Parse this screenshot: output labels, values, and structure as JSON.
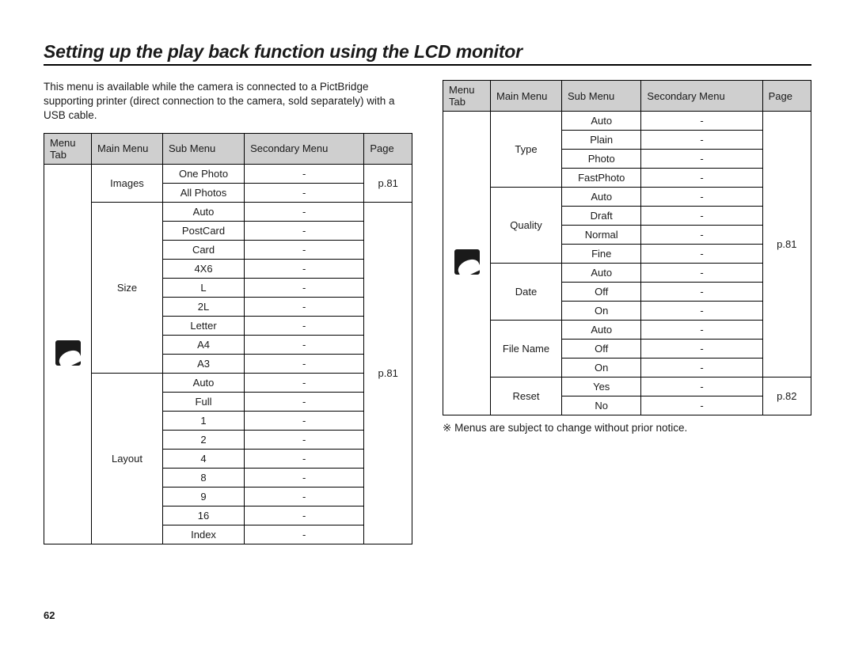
{
  "title": "Setting up the play back function using the LCD monitor",
  "intro": "This menu is available while the camera is connected to a PictBridge supporting printer (direct connection to the camera, sold separately) with a USB cable.",
  "headers": {
    "menuTab": "Menu Tab",
    "mainMenu": "Main Menu",
    "subMenu": "Sub Menu",
    "secondaryMenu": "Secondary Menu",
    "page": "Page"
  },
  "left": {
    "iconName": "pictbridge-icon",
    "groups": [
      {
        "main": "Images",
        "page": "p.81",
        "rows": [
          {
            "sub": "One Photo",
            "sec": "-"
          },
          {
            "sub": "All Photos",
            "sec": "-"
          }
        ]
      },
      {
        "main": "Size",
        "pageGroupStart": true,
        "page": "p.81",
        "rows": [
          {
            "sub": "Auto",
            "sec": "-"
          },
          {
            "sub": "PostCard",
            "sec": "-"
          },
          {
            "sub": "Card",
            "sec": "-"
          },
          {
            "sub": "4X6",
            "sec": "-"
          },
          {
            "sub": "L",
            "sec": "-"
          },
          {
            "sub": "2L",
            "sec": "-"
          },
          {
            "sub": "Letter",
            "sec": "-"
          },
          {
            "sub": "A4",
            "sec": "-"
          },
          {
            "sub": "A3",
            "sec": "-"
          }
        ]
      },
      {
        "main": "Layout",
        "rows": [
          {
            "sub": "Auto",
            "sec": "-"
          },
          {
            "sub": "Full",
            "sec": "-"
          },
          {
            "sub": "1",
            "sec": "-"
          },
          {
            "sub": "2",
            "sec": "-"
          },
          {
            "sub": "4",
            "sec": "-"
          },
          {
            "sub": "8",
            "sec": "-"
          },
          {
            "sub": "9",
            "sec": "-"
          },
          {
            "sub": "16",
            "sec": "-"
          },
          {
            "sub": "Index",
            "sec": "-"
          }
        ]
      }
    ]
  },
  "right": {
    "iconName": "pictbridge-icon",
    "groups": [
      {
        "main": "Type",
        "pageGroupStart": true,
        "page": "p.81",
        "rows": [
          {
            "sub": "Auto",
            "sec": "-"
          },
          {
            "sub": "Plain",
            "sec": "-"
          },
          {
            "sub": "Photo",
            "sec": "-"
          },
          {
            "sub": "FastPhoto",
            "sec": "-"
          }
        ]
      },
      {
        "main": "Quality",
        "rows": [
          {
            "sub": "Auto",
            "sec": "-"
          },
          {
            "sub": "Draft",
            "sec": "-"
          },
          {
            "sub": "Normal",
            "sec": "-"
          },
          {
            "sub": "Fine",
            "sec": "-"
          }
        ]
      },
      {
        "main": "Date",
        "rows": [
          {
            "sub": "Auto",
            "sec": "-"
          },
          {
            "sub": "Off",
            "sec": "-"
          },
          {
            "sub": "On",
            "sec": "-"
          }
        ]
      },
      {
        "main": "File Name",
        "rows": [
          {
            "sub": "Auto",
            "sec": "-"
          },
          {
            "sub": "Off",
            "sec": "-"
          },
          {
            "sub": "On",
            "sec": "-"
          }
        ]
      },
      {
        "main": "Reset",
        "pageGroupStart": true,
        "page": "p.82",
        "rows": [
          {
            "sub": "Yes",
            "sec": "-"
          },
          {
            "sub": "No",
            "sec": "-"
          }
        ]
      }
    ]
  },
  "noteSymbol": "※",
  "note": "Menus are subject to change without prior notice.",
  "pageNumber": "62"
}
